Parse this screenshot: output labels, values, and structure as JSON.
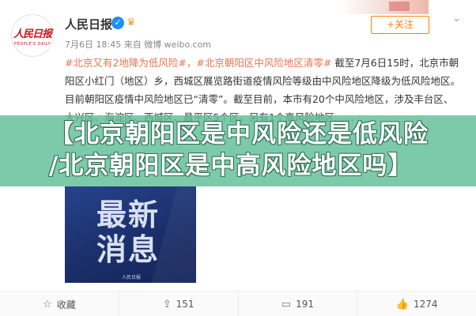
{
  "account": {
    "logo_text": "人民日报",
    "logo_sub": "PEOPLE'S DAILY",
    "name": "人民日报",
    "verified_icon": "verified-badge-icon",
    "meta": "7月6日 18:45 来自 微博 weibo.com"
  },
  "follow_button": "+关注",
  "post": {
    "hashtags": "#北京又有2地降为低风险#，#北京朝阳区中风险地区清零#",
    "text": "截至7月6日15时，北京市朝阳区小红门（地区）乡，西城区展览路街道疫情风险等级由中风险地区降级为低风险地区。目前朝阳区疫情中风险地区已“清零”。截至目前，本市有20个中风险地区，涉及丰台区、大兴区、海淀区、西城区、昌平区5个区。另有1个高风险地区……"
  },
  "overlay": {
    "line1": "【北京朝阳区是中风险还是低风险",
    "line2": "/北京朝阳区是中高风险地区吗】"
  },
  "image": {
    "text_top": "最新",
    "text_bottom": "消息",
    "source": "人民日报"
  },
  "actions": [
    {
      "icon": "favorite-icon",
      "glyph": "☆",
      "label": "收藏"
    },
    {
      "icon": "share-icon",
      "glyph": "⇪",
      "label": "151"
    },
    {
      "icon": "comment-icon",
      "glyph": "▭",
      "label": "191"
    },
    {
      "icon": "like-icon",
      "glyph": "👍",
      "label": "1274"
    }
  ],
  "colors": {
    "accent_orange": "#ff8200",
    "hashtag": "#eb7350",
    "overlay_green": "#60be98",
    "verified_blue": "#1b8ffa"
  }
}
